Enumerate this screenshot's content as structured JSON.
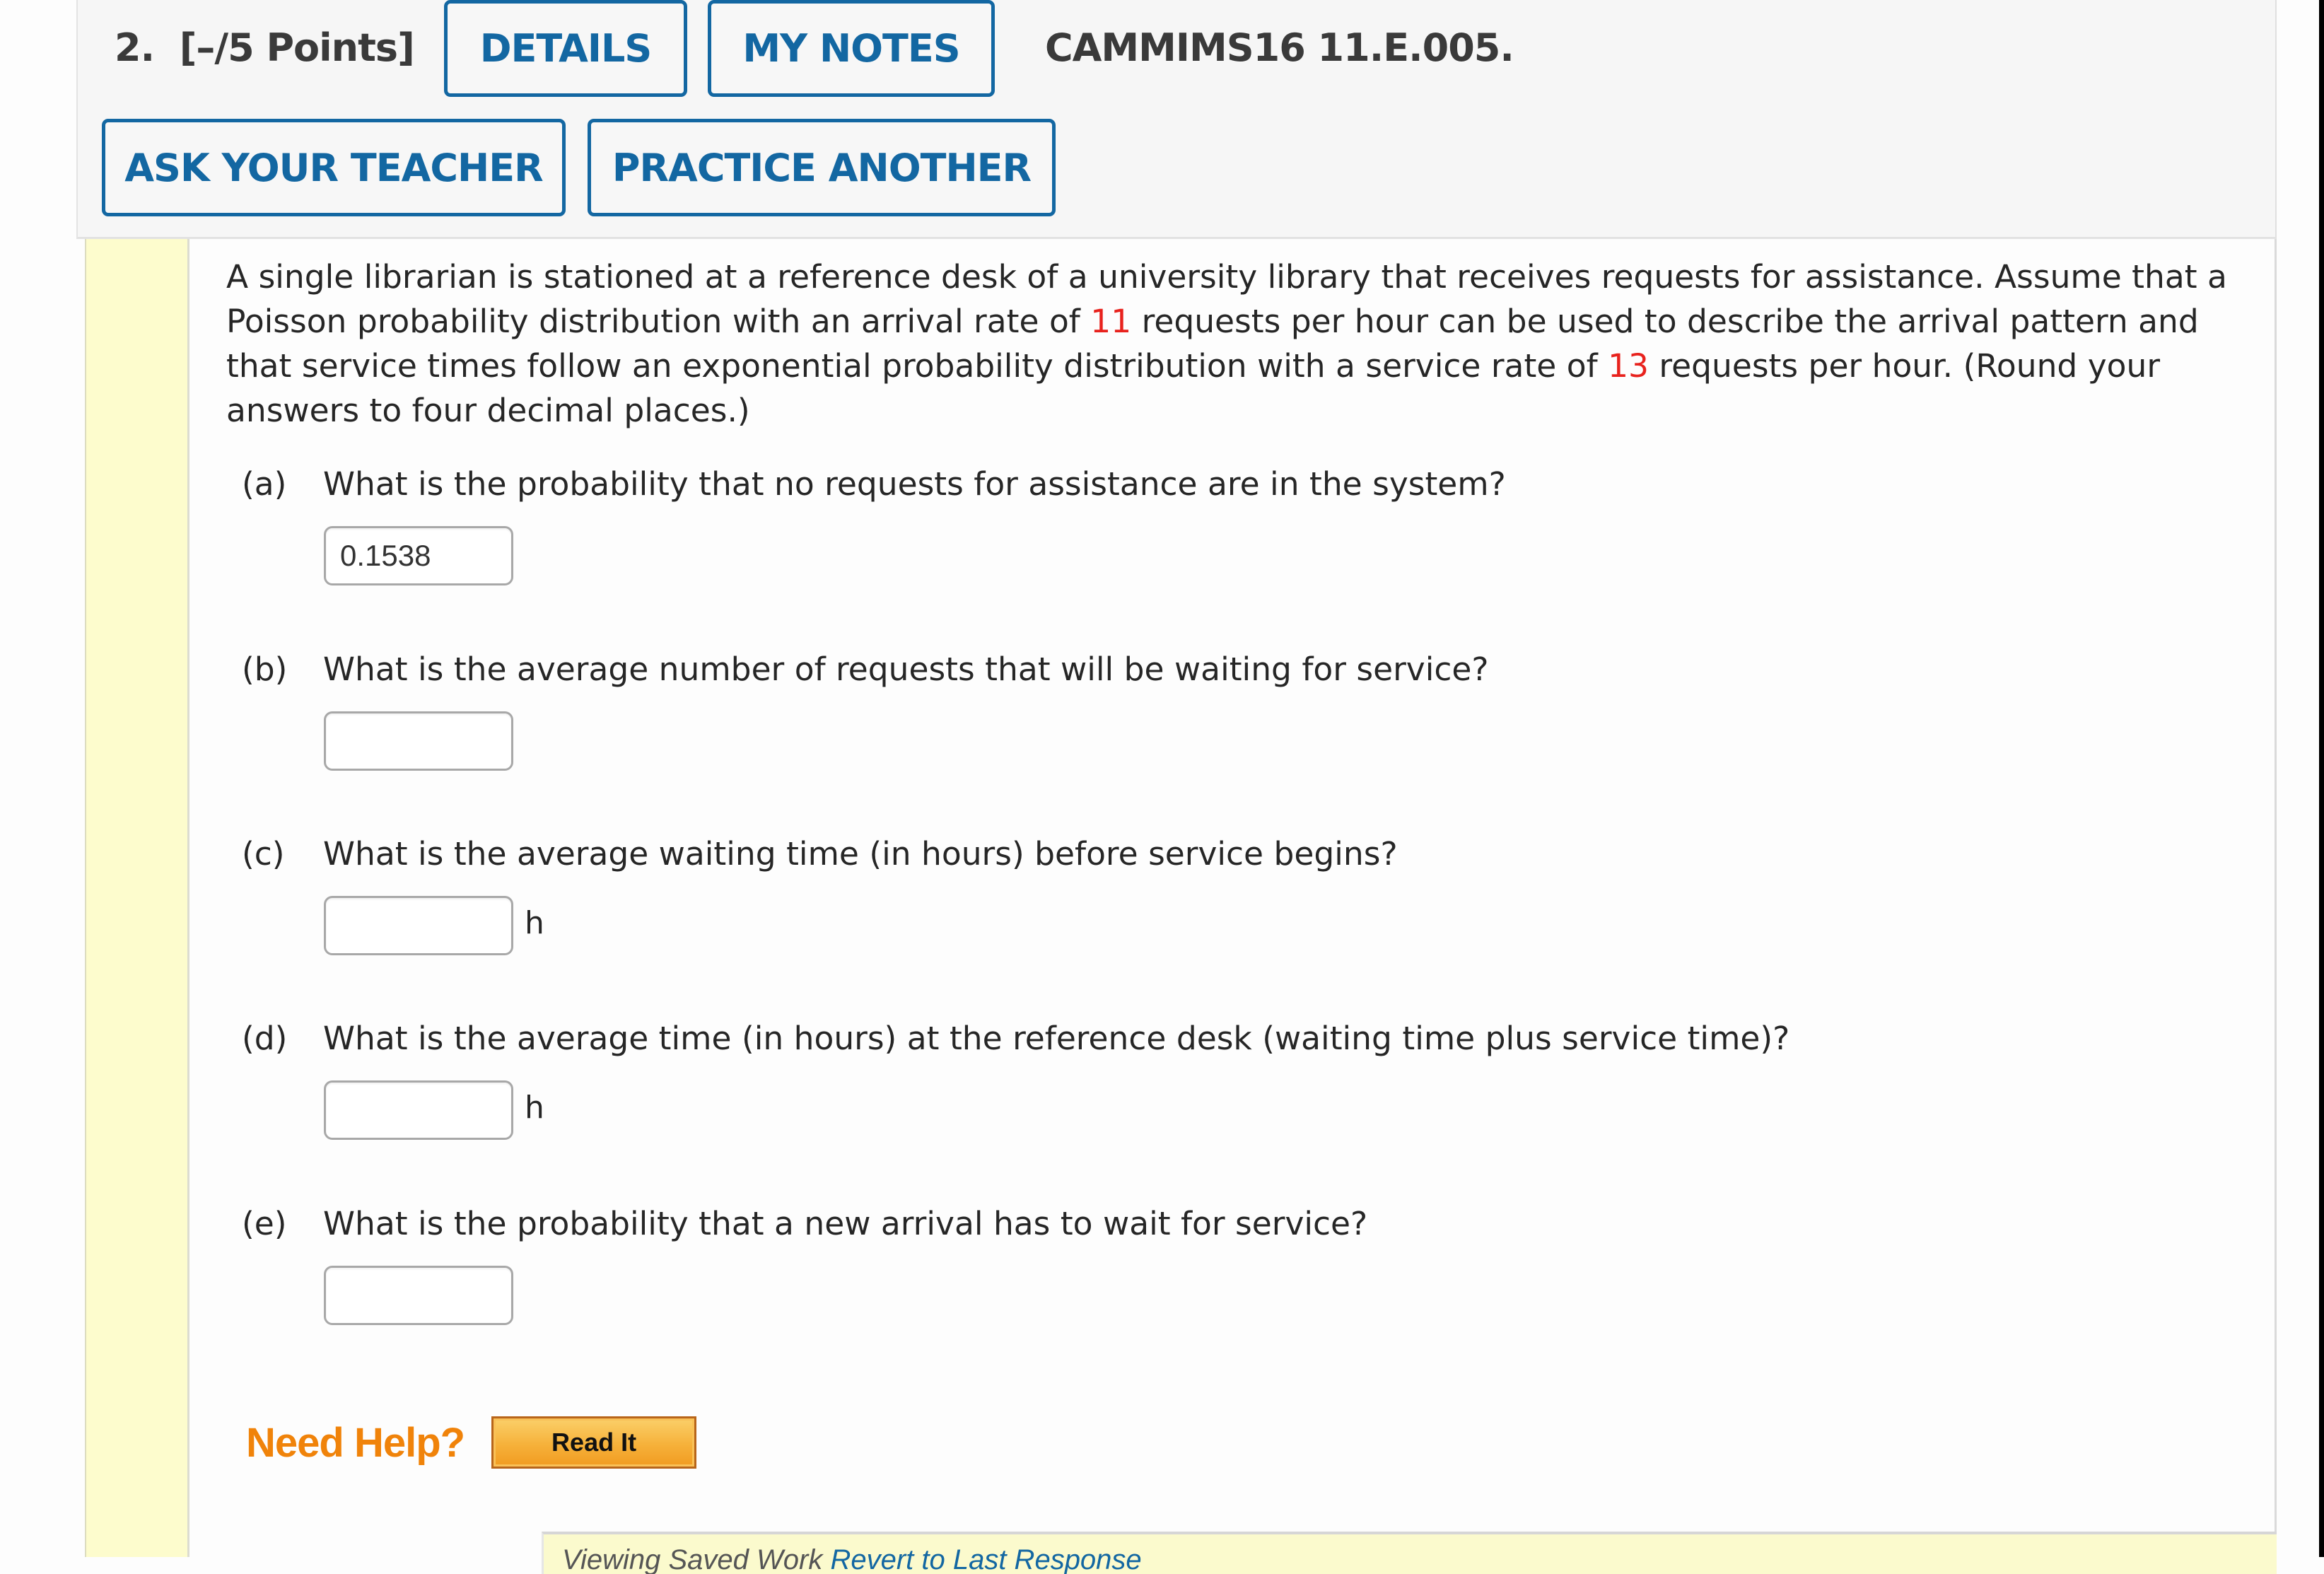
{
  "header": {
    "question_number": "2.",
    "points": "[–/5 Points]",
    "details_button": "DETAILS",
    "my_notes_button": "MY NOTES",
    "question_code": "CAMMIMS16 11.E.005.",
    "ask_teacher_button": "ASK YOUR TEACHER",
    "practice_another_button": "PRACTICE ANOTHER"
  },
  "problem": {
    "intro_part1": "A single librarian is stationed at a reference desk of a university library that receives requests for assistance. Assume that a Poisson probability distribution with an arrival rate of ",
    "arrival_rate": "11",
    "intro_part2": " requests per hour can be used to describe the arrival pattern and that service times follow an exponential probability distribution with a service rate of ",
    "service_rate": "13",
    "intro_part3": " requests per hour. (Round your answers to four decimal places.)",
    "highlight_color": "#e8221d"
  },
  "parts": [
    {
      "letter": "(a)",
      "question": "What is the probability that no requests for assistance are in the system?",
      "value": "0.1538",
      "unit": ""
    },
    {
      "letter": "(b)",
      "question": "What is the average number of requests that will be waiting for service?",
      "value": "",
      "unit": ""
    },
    {
      "letter": "(c)",
      "question": "What is the average waiting time (in hours) before service begins?",
      "value": "",
      "unit": "h"
    },
    {
      "letter": "(d)",
      "question": "What is the average time (in hours) at the reference desk (waiting time plus service time)?",
      "value": "",
      "unit": "h"
    },
    {
      "letter": "(e)",
      "question": "What is the probability that a new arrival has to wait for service?",
      "value": "",
      "unit": ""
    }
  ],
  "help": {
    "need_help_label": "Need Help?",
    "read_it_button": "Read It"
  },
  "saved_work": {
    "label": "Viewing Saved Work ",
    "revert_link": "Revert to Last Response"
  },
  "colors": {
    "button_blue": "#1367a2",
    "need_help_orange": "#f0830a",
    "stripe_yellow": "#fdfccd"
  }
}
